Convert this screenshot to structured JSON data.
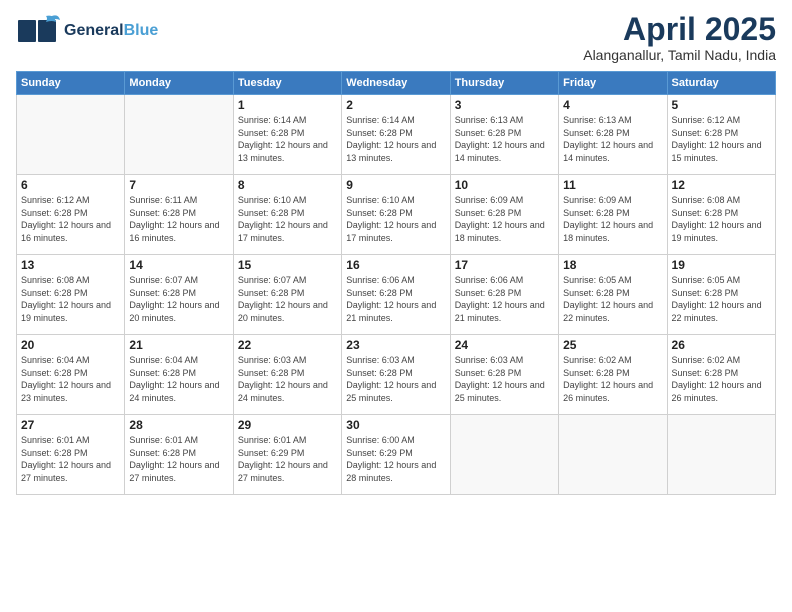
{
  "header": {
    "logo_line1": "General",
    "logo_line2": "Blue",
    "month_title": "April 2025",
    "location": "Alanganallur, Tamil Nadu, India"
  },
  "days_of_week": [
    "Sunday",
    "Monday",
    "Tuesday",
    "Wednesday",
    "Thursday",
    "Friday",
    "Saturday"
  ],
  "weeks": [
    [
      {
        "day": "",
        "sunrise": "",
        "sunset": "",
        "daylight": ""
      },
      {
        "day": "",
        "sunrise": "",
        "sunset": "",
        "daylight": ""
      },
      {
        "day": "1",
        "sunrise": "Sunrise: 6:14 AM",
        "sunset": "Sunset: 6:28 PM",
        "daylight": "Daylight: 12 hours and 13 minutes."
      },
      {
        "day": "2",
        "sunrise": "Sunrise: 6:14 AM",
        "sunset": "Sunset: 6:28 PM",
        "daylight": "Daylight: 12 hours and 13 minutes."
      },
      {
        "day": "3",
        "sunrise": "Sunrise: 6:13 AM",
        "sunset": "Sunset: 6:28 PM",
        "daylight": "Daylight: 12 hours and 14 minutes."
      },
      {
        "day": "4",
        "sunrise": "Sunrise: 6:13 AM",
        "sunset": "Sunset: 6:28 PM",
        "daylight": "Daylight: 12 hours and 14 minutes."
      },
      {
        "day": "5",
        "sunrise": "Sunrise: 6:12 AM",
        "sunset": "Sunset: 6:28 PM",
        "daylight": "Daylight: 12 hours and 15 minutes."
      }
    ],
    [
      {
        "day": "6",
        "sunrise": "Sunrise: 6:12 AM",
        "sunset": "Sunset: 6:28 PM",
        "daylight": "Daylight: 12 hours and 16 minutes."
      },
      {
        "day": "7",
        "sunrise": "Sunrise: 6:11 AM",
        "sunset": "Sunset: 6:28 PM",
        "daylight": "Daylight: 12 hours and 16 minutes."
      },
      {
        "day": "8",
        "sunrise": "Sunrise: 6:10 AM",
        "sunset": "Sunset: 6:28 PM",
        "daylight": "Daylight: 12 hours and 17 minutes."
      },
      {
        "day": "9",
        "sunrise": "Sunrise: 6:10 AM",
        "sunset": "Sunset: 6:28 PM",
        "daylight": "Daylight: 12 hours and 17 minutes."
      },
      {
        "day": "10",
        "sunrise": "Sunrise: 6:09 AM",
        "sunset": "Sunset: 6:28 PM",
        "daylight": "Daylight: 12 hours and 18 minutes."
      },
      {
        "day": "11",
        "sunrise": "Sunrise: 6:09 AM",
        "sunset": "Sunset: 6:28 PM",
        "daylight": "Daylight: 12 hours and 18 minutes."
      },
      {
        "day": "12",
        "sunrise": "Sunrise: 6:08 AM",
        "sunset": "Sunset: 6:28 PM",
        "daylight": "Daylight: 12 hours and 19 minutes."
      }
    ],
    [
      {
        "day": "13",
        "sunrise": "Sunrise: 6:08 AM",
        "sunset": "Sunset: 6:28 PM",
        "daylight": "Daylight: 12 hours and 19 minutes."
      },
      {
        "day": "14",
        "sunrise": "Sunrise: 6:07 AM",
        "sunset": "Sunset: 6:28 PM",
        "daylight": "Daylight: 12 hours and 20 minutes."
      },
      {
        "day": "15",
        "sunrise": "Sunrise: 6:07 AM",
        "sunset": "Sunset: 6:28 PM",
        "daylight": "Daylight: 12 hours and 20 minutes."
      },
      {
        "day": "16",
        "sunrise": "Sunrise: 6:06 AM",
        "sunset": "Sunset: 6:28 PM",
        "daylight": "Daylight: 12 hours and 21 minutes."
      },
      {
        "day": "17",
        "sunrise": "Sunrise: 6:06 AM",
        "sunset": "Sunset: 6:28 PM",
        "daylight": "Daylight: 12 hours and 21 minutes."
      },
      {
        "day": "18",
        "sunrise": "Sunrise: 6:05 AM",
        "sunset": "Sunset: 6:28 PM",
        "daylight": "Daylight: 12 hours and 22 minutes."
      },
      {
        "day": "19",
        "sunrise": "Sunrise: 6:05 AM",
        "sunset": "Sunset: 6:28 PM",
        "daylight": "Daylight: 12 hours and 22 minutes."
      }
    ],
    [
      {
        "day": "20",
        "sunrise": "Sunrise: 6:04 AM",
        "sunset": "Sunset: 6:28 PM",
        "daylight": "Daylight: 12 hours and 23 minutes."
      },
      {
        "day": "21",
        "sunrise": "Sunrise: 6:04 AM",
        "sunset": "Sunset: 6:28 PM",
        "daylight": "Daylight: 12 hours and 24 minutes."
      },
      {
        "day": "22",
        "sunrise": "Sunrise: 6:03 AM",
        "sunset": "Sunset: 6:28 PM",
        "daylight": "Daylight: 12 hours and 24 minutes."
      },
      {
        "day": "23",
        "sunrise": "Sunrise: 6:03 AM",
        "sunset": "Sunset: 6:28 PM",
        "daylight": "Daylight: 12 hours and 25 minutes."
      },
      {
        "day": "24",
        "sunrise": "Sunrise: 6:03 AM",
        "sunset": "Sunset: 6:28 PM",
        "daylight": "Daylight: 12 hours and 25 minutes."
      },
      {
        "day": "25",
        "sunrise": "Sunrise: 6:02 AM",
        "sunset": "Sunset: 6:28 PM",
        "daylight": "Daylight: 12 hours and 26 minutes."
      },
      {
        "day": "26",
        "sunrise": "Sunrise: 6:02 AM",
        "sunset": "Sunset: 6:28 PM",
        "daylight": "Daylight: 12 hours and 26 minutes."
      }
    ],
    [
      {
        "day": "27",
        "sunrise": "Sunrise: 6:01 AM",
        "sunset": "Sunset: 6:28 PM",
        "daylight": "Daylight: 12 hours and 27 minutes."
      },
      {
        "day": "28",
        "sunrise": "Sunrise: 6:01 AM",
        "sunset": "Sunset: 6:28 PM",
        "daylight": "Daylight: 12 hours and 27 minutes."
      },
      {
        "day": "29",
        "sunrise": "Sunrise: 6:01 AM",
        "sunset": "Sunset: 6:29 PM",
        "daylight": "Daylight: 12 hours and 27 minutes."
      },
      {
        "day": "30",
        "sunrise": "Sunrise: 6:00 AM",
        "sunset": "Sunset: 6:29 PM",
        "daylight": "Daylight: 12 hours and 28 minutes."
      },
      {
        "day": "",
        "sunrise": "",
        "sunset": "",
        "daylight": ""
      },
      {
        "day": "",
        "sunrise": "",
        "sunset": "",
        "daylight": ""
      },
      {
        "day": "",
        "sunrise": "",
        "sunset": "",
        "daylight": ""
      }
    ]
  ]
}
